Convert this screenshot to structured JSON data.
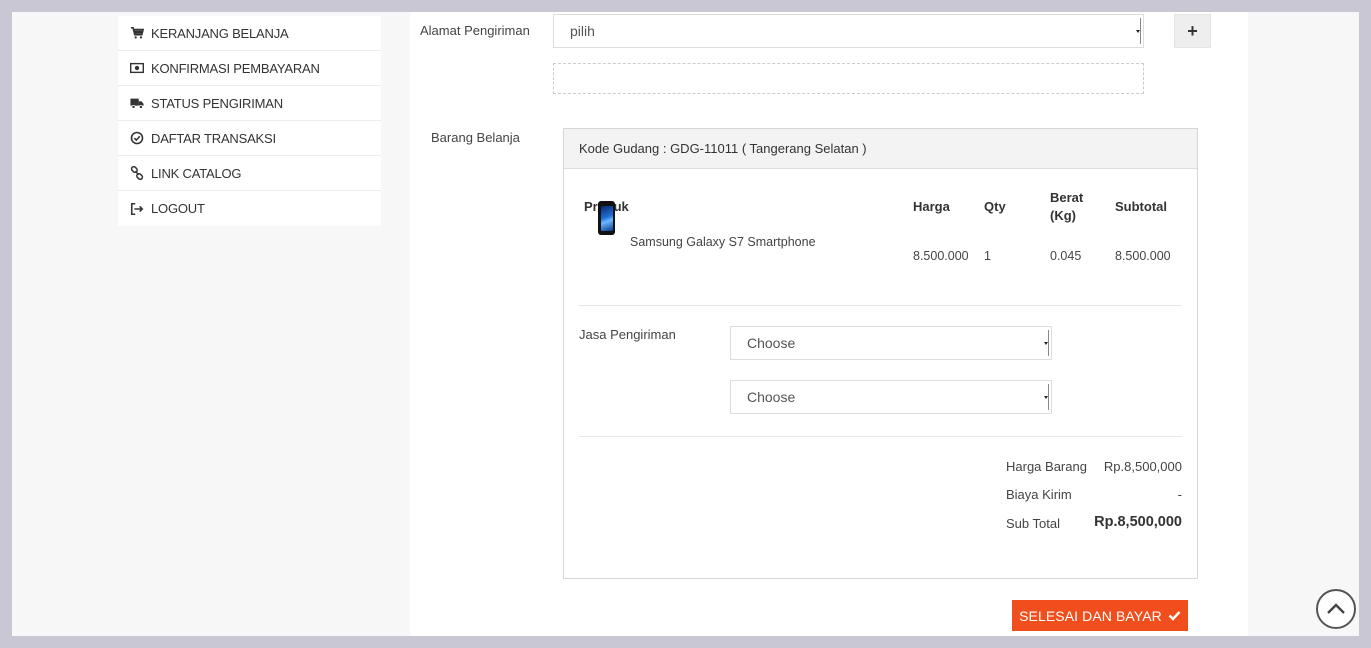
{
  "sidebar": {
    "items": [
      {
        "label": "KERANJANG BELANJA",
        "icon": "cart-icon"
      },
      {
        "label": "KONFIRMASI PEMBAYARAN",
        "icon": "money-icon"
      },
      {
        "label": "STATUS PENGIRIMAN",
        "icon": "truck-icon"
      },
      {
        "label": "DAFTAR TRANSAKSI",
        "icon": "check-circle-icon"
      },
      {
        "label": "LINK CATALOG",
        "icon": "link-icon"
      },
      {
        "label": "LOGOUT",
        "icon": "logout-icon"
      }
    ]
  },
  "shipping_address": {
    "label": "Alamat Pengiriman",
    "selected": "pilih",
    "add_label": "+"
  },
  "cart": {
    "label": "Barang Belanja",
    "warehouse": "Kode Gudang : GDG-11011 ( Tangerang Selatan )",
    "headers": {
      "product": "Produk",
      "price": "Harga",
      "qty": "Qty",
      "weight_line1": "Berat",
      "weight_line2": "(Kg)",
      "subtotal": "Subtotal"
    },
    "items": [
      {
        "name": "Samsung Galaxy S7 Smartphone",
        "price": "8.500.000",
        "qty": "1",
        "weight": "0.045",
        "subtotal": "8.500.000"
      }
    ],
    "courier": {
      "label": "Jasa Pengiriman",
      "select1": "Choose",
      "select2": "Choose"
    },
    "summary": {
      "goods_label": "Harga Barang",
      "goods_value": "Rp.8,500,000",
      "shipping_label": "Biaya Kirim",
      "shipping_value": "-",
      "total_label": "Sub Total",
      "total_value": "Rp.8,500,000"
    }
  },
  "actions": {
    "pay_label": "SELESAI DAN BAYAR"
  },
  "colors": {
    "accent": "#f04e1c",
    "frame": "#c9c7d4"
  }
}
